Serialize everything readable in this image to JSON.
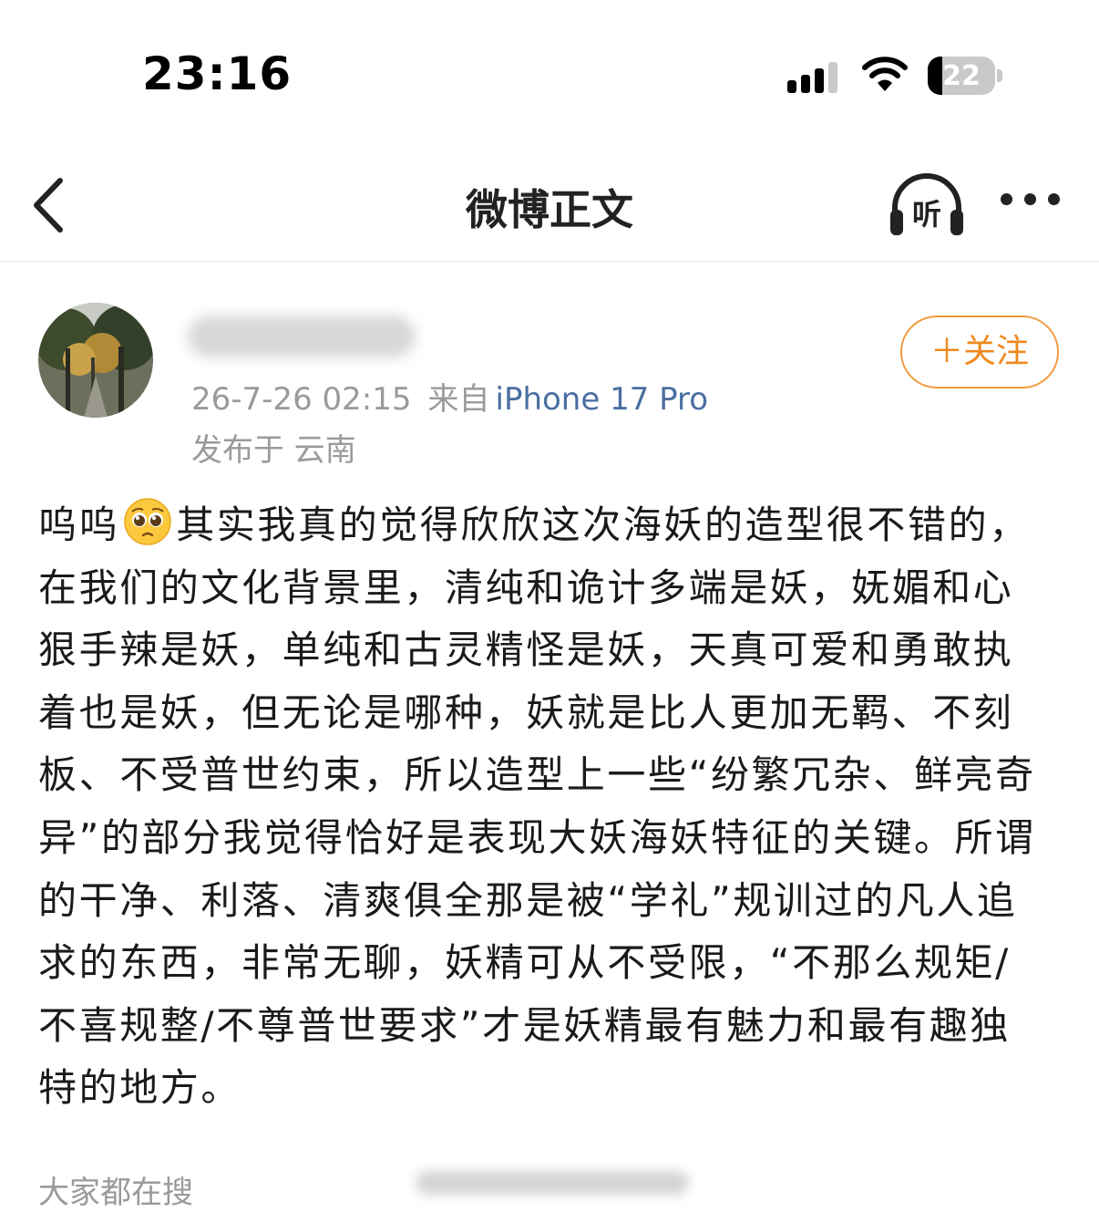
{
  "status_bar": {
    "time": "23:16",
    "battery": "22",
    "battery_level_percent": 22
  },
  "nav": {
    "title": "微博正文",
    "listen_label": "听"
  },
  "post": {
    "username": "",
    "timestamp": "26-7-26 02:15",
    "source_prefix": "来自",
    "device": "iPhone 17 Pro",
    "location": "发布于 云南",
    "follow_label": "＋关注",
    "text_start": "呜呜",
    "emoji_icon": "pleading-face-emoji",
    "text_rest": "其实我真的觉得欣欣这次海妖的造型很不错的，在我们的文化背景里，清纯和诡计多端是妖，妩媚和心狠手辣是妖，单纯和古灵精怪是妖，天真可爱和勇敢执着也是妖，但无论是哪种，妖就是比人更加无羁、不刻板、不受普世约束，所以造型上一些“纷繁冗杂、鲜亮奇异”的部分我觉得恰好是表现大妖海妖特征的关键。所谓的干净、利落、清爽俱全那是被“学礼”规训过的凡人追求的东西，非常无聊，妖精可从不受限，“不那么规矩/不喜规整/不尊普世要求”才是妖精最有魅力和最有趣独特的地方。"
  },
  "footer": {
    "search_hint": "大家都在搜",
    "search_term": ""
  },
  "colors": {
    "accent_orange": "#ed8a1f",
    "link_blue": "#4a6fa0",
    "meta_gray": "#9a9a9a"
  }
}
